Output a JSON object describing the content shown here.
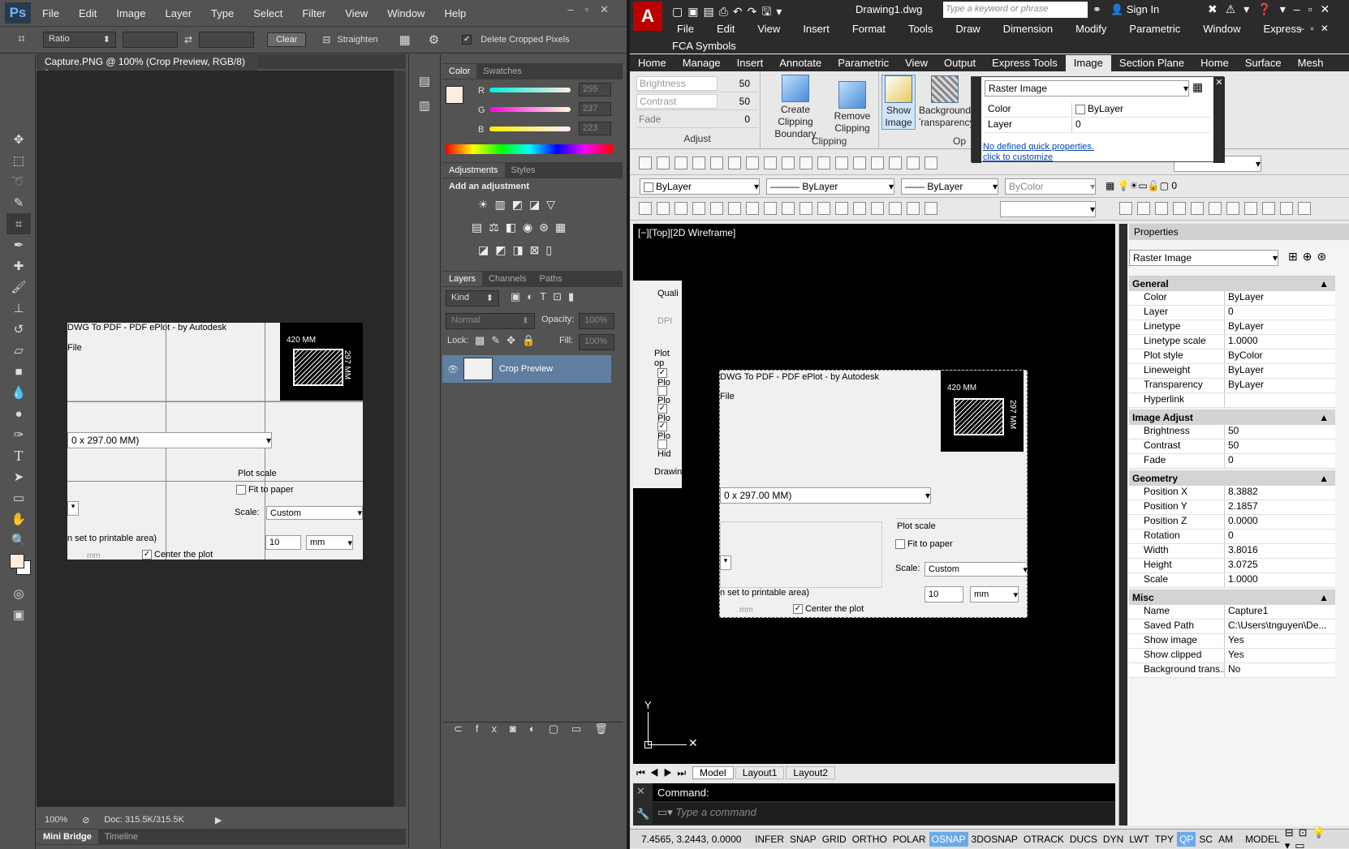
{
  "ps": {
    "logo": "Ps",
    "menu": [
      "File",
      "Edit",
      "Image",
      "Layer",
      "Type",
      "Select",
      "Filter",
      "View",
      "Window",
      "Help"
    ],
    "options": {
      "ratio": "Ratio",
      "clear": "Clear",
      "straighten": "Straighten",
      "delete_cropped": "Delete Cropped Pixels"
    },
    "doc_tab": "Capture.PNG @ 100% (Crop Preview, RGB/8) *",
    "status": {
      "zoom": "100%",
      "doc": "Doc: 315.5K/315.5K"
    },
    "bottom_tabs": [
      "Mini Bridge",
      "Timeline"
    ],
    "color_panel": {
      "tabs": [
        "Color",
        "Swatches"
      ],
      "r_label": "R",
      "g_label": "G",
      "b_label": "B",
      "r": "255",
      "g": "237",
      "b": "223"
    },
    "adjust_panel": {
      "tabs": [
        "Adjustments",
        "Styles"
      ],
      "title": "Add an adjustment"
    },
    "layers_panel": {
      "tabs": [
        "Layers",
        "Channels",
        "Paths"
      ],
      "kind": "Kind",
      "mode": "Normal",
      "opacity_label": "Opacity:",
      "opacity": "100%",
      "lock_label": "Lock:",
      "fill_label": "Fill:",
      "fill": "100%",
      "layer_name": "Crop Preview"
    },
    "canvas": {
      "title_text": "DWG To PDF - PDF ePlot - by Autodesk",
      "file_text": "File",
      "paper_text": "0 x 297.00 MM)",
      "plot_scale": "Plot scale",
      "fit_to_paper": "Fit to paper",
      "scale_label": "Scale:",
      "scale_value": "Custom",
      "scale_num": "10",
      "unit": "mm",
      "printable": "n set to printable area)",
      "mm": "mm",
      "center": "Center the plot",
      "dim_w": "420 MM",
      "dim_h": "297 MM"
    }
  },
  "cad": {
    "title": "Drawing1.dwg",
    "search_placeholder": "Type a keyword or phrase",
    "sign_in": "Sign In",
    "menu": [
      "File",
      "Edit",
      "View",
      "Insert",
      "Format",
      "Tools",
      "Draw",
      "Dimension",
      "Modify",
      "Parametric",
      "Window",
      "Express"
    ],
    "fca": "FCA Symbols",
    "ribbon_tabs": [
      "Home",
      "Manage",
      "Insert",
      "Annotate",
      "Parametric",
      "View",
      "Output",
      "Express Tools",
      "Image",
      "Section Plane",
      "Home",
      "Surface",
      "Mesh"
    ],
    "adjust": {
      "brightness_label": "Brightness",
      "brightness": "50",
      "contrast_label": "Contrast",
      "contrast": "50",
      "fade_label": "Fade",
      "fade": "0",
      "group": "Adjust"
    },
    "clipping": {
      "create": "Create Clipping Boundary",
      "remove": "Remove Clipping",
      "group": "Clipping"
    },
    "options": {
      "show": "Show Image",
      "bg": "Background Transparency",
      "group": "Op"
    },
    "quickprops": {
      "type": "Raster Image",
      "color_label": "Color",
      "color": "ByLayer",
      "layer_label": "Layer",
      "layer": "0",
      "link1": "No defined quick properties.",
      "link2": "click to customize"
    },
    "layer_bar": {
      "bylayer1": "ByLayer",
      "bylayer2": "ByLayer",
      "bylayer3": "ByLayer",
      "bycolor": "ByColor",
      "layer0": "0"
    },
    "viewport_label": "[−][Top][2D Wireframe]",
    "dialog": {
      "quality": "Quali",
      "dpi": "DPI",
      "plot_opt": "Plot op",
      "pl1": "Plo",
      "pl2": "Plo",
      "pl3": "Plo",
      "pl4": "Plo",
      "hi": "Hid",
      "drawing": "Drawin"
    },
    "layout_tabs": [
      "Model",
      "Layout1",
      "Layout2"
    ],
    "command_label": "Command:",
    "command_placeholder": "Type a command",
    "coords": "7.4565, 3.2443, 0.0000",
    "status_buttons": [
      "INFER",
      "SNAP",
      "GRID",
      "ORTHO",
      "POLAR",
      "OSNAP",
      "3DOSNAP",
      "OTRACK",
      "DUCS",
      "DYN",
      "LWT",
      "TPY",
      "QP",
      "SC",
      "AM"
    ],
    "status_on": [
      "OSNAP",
      "QP"
    ],
    "model": "MODEL",
    "properties": {
      "title": "Properties",
      "type": "Raster Image",
      "general": {
        "title": "General",
        "rows": [
          [
            "Color",
            "ByLayer"
          ],
          [
            "Layer",
            "0"
          ],
          [
            "Linetype",
            "ByLayer"
          ],
          [
            "Linetype scale",
            "1.0000"
          ],
          [
            "Plot style",
            "ByColor"
          ],
          [
            "Lineweight",
            "ByLayer"
          ],
          [
            "Transparency",
            "ByLayer"
          ],
          [
            "Hyperlink",
            ""
          ]
        ]
      },
      "image_adjust": {
        "title": "Image Adjust",
        "rows": [
          [
            "Brightness",
            "50"
          ],
          [
            "Contrast",
            "50"
          ],
          [
            "Fade",
            "0"
          ]
        ]
      },
      "geometry": {
        "title": "Geometry",
        "rows": [
          [
            "Position X",
            "8.3882"
          ],
          [
            "Position Y",
            "2.1857"
          ],
          [
            "Position Z",
            "0.0000"
          ],
          [
            "Rotation",
            "0"
          ],
          [
            "Width",
            "3.8016"
          ],
          [
            "Height",
            "3.0725"
          ],
          [
            "Scale",
            "1.0000"
          ]
        ]
      },
      "misc": {
        "title": "Misc",
        "rows": [
          [
            "Name",
            "Capture1"
          ],
          [
            "Saved Path",
            "C:\\Users\\tnguyen\\De..."
          ],
          [
            "Show image",
            "Yes"
          ],
          [
            "Show clipped",
            "Yes"
          ],
          [
            "Background trans...",
            "No"
          ]
        ]
      }
    }
  }
}
